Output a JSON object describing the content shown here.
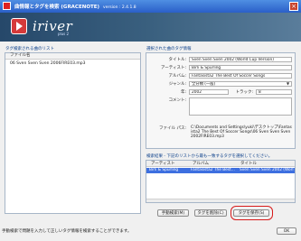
{
  "window": {
    "title": "曲情報とタグを検索 (GRACENOTE)",
    "version": "version : 2.4.1.8",
    "close_glyph": "×"
  },
  "banner": {
    "logo_text": "iriver",
    "logo_sub": "plus 2"
  },
  "left_panel": {
    "label": "タグ検索される曲のリスト",
    "column_header": "ファイル名",
    "rows": [
      "06 Sven Sven Sven 2006FIRE03.mp3"
    ]
  },
  "right_panel": {
    "label": "選択された曲のタグ情報",
    "fields": {
      "title": {
        "label": "タイトル:",
        "value": "Sven Sven Sven 2002 (World Cup Version)"
      },
      "artist": {
        "label": "アーティスト:",
        "value": "Birli & Spurling"
      },
      "album": {
        "label": "アルバム:",
        "value": "Fantasista2 The Best Of Soccer Songs"
      },
      "genre": {
        "label": "ジャンル:",
        "value": "全分類 (一般)"
      },
      "year": {
        "label": "年:",
        "value": "2002"
      },
      "track_label": "トラック:",
      "track": "8",
      "comment": {
        "label": "コメント:",
        "value": ""
      },
      "path": {
        "label": "ファイル パス:",
        "value": "C:\\Documents and Settings\\yuki\\デスクトップ\\Fantasista2 The Best Of Soccer Songs\\06 Sven Sven Sven 2002FIRE03.mp3"
      }
    }
  },
  "results": {
    "label": "検索結果 - 下記のリストから最も一致するタグを選択してください。",
    "columns": [
      "アーティスト",
      "アルバム",
      "タイトル"
    ],
    "rows": [
      {
        "artist": "Birli & Spurling",
        "album": "Fantasista2 The Best...",
        "title": "Sven Sven Sven 2002 (Worl..."
      }
    ]
  },
  "buttons": {
    "manual": "手動検索(M)",
    "tag_delete": "タグを削除(C)",
    "tag_save": "タグを保存(S)",
    "ok": "OK"
  },
  "status_text": "手動検索で問題を入力して正しいタグ情報を検索することができます。",
  "colors": {
    "titlebar": "#2a5fc8",
    "selected_row": "#3d6fe0",
    "highlight": "#d81b1b"
  }
}
